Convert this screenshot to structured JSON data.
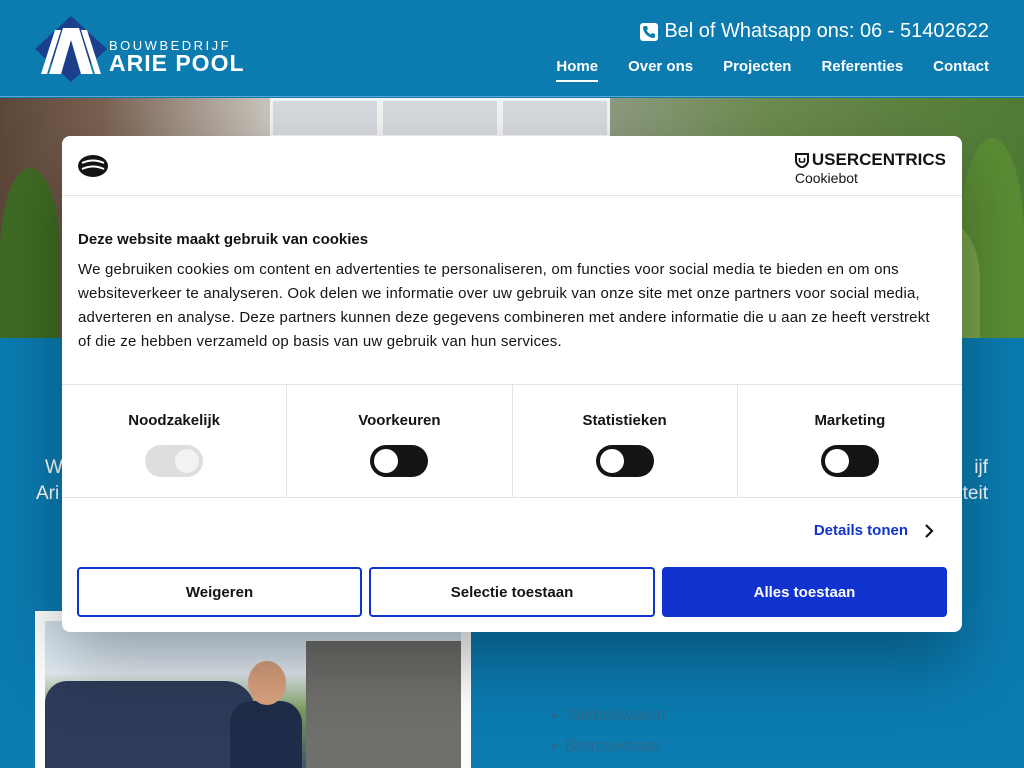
{
  "brand": {
    "sub": "BOUWBEDRIJF",
    "name": "ARIE POOL"
  },
  "header": {
    "phone_text": "Bel of Whatsapp ons: 06 - 51402622",
    "nav": [
      {
        "label": "Home",
        "active": true
      },
      {
        "label": "Over ons",
        "active": false
      },
      {
        "label": "Projecten",
        "active": false
      },
      {
        "label": "Referenties",
        "active": false
      },
      {
        "label": "Contact",
        "active": false
      }
    ]
  },
  "background_text": {
    "left_line1": "W",
    "left_line2": "Ari",
    "right_line1": "ijf",
    "right_line2": "teit"
  },
  "features": [
    "Vakbekwaam",
    "Betrouwbaar"
  ],
  "cookie_dialog": {
    "provider_top": "USERCENTRICS",
    "provider_bottom": "Cookiebot",
    "title": "Deze website maakt gebruik van cookies",
    "body": "We gebruiken cookies om content en advertenties te personaliseren, om functies voor social media te bieden en om ons websiteverkeer te analyseren. Ook delen we informatie over uw gebruik van onze site met onze partners voor social media, adverteren en analyse. Deze partners kunnen deze gegevens combineren met andere informatie die u aan ze heeft verstrekt of die ze hebben verzameld op basis van uw gebruik van hun services.",
    "toggles": [
      {
        "label": "Noodzakelijk",
        "checked": true,
        "disabled": true
      },
      {
        "label": "Voorkeuren",
        "checked": false,
        "disabled": false
      },
      {
        "label": "Statistieken",
        "checked": false,
        "disabled": false
      },
      {
        "label": "Marketing",
        "checked": false,
        "disabled": false
      }
    ],
    "details_label": "Details tonen",
    "buttons": {
      "deny": "Weigeren",
      "selection": "Selectie toestaan",
      "allow_all": "Alles toestaan"
    }
  },
  "colors": {
    "site_blue": "#0b7bb0",
    "accent_blue": "#1032cf"
  }
}
